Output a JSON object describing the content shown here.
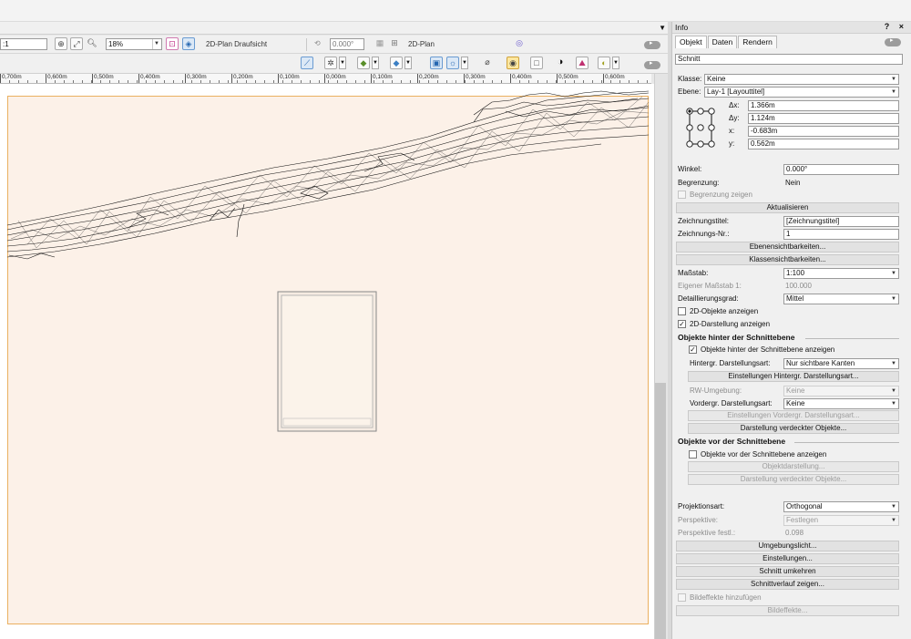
{
  "view_bar": {
    "scale_value": ":1",
    "zoom_value": "18%",
    "plan_label": "2D-Plan Draufsicht",
    "angle_value": "0.000°",
    "plan2_label": "2D-Plan"
  },
  "ruler": {
    "labels": [
      "0,700m",
      "0,600m",
      "0,500m",
      "0,400m",
      "0,300m",
      "0,200m",
      "0,100m",
      "0,000m",
      "0,100m",
      "0,200m",
      "0,300m",
      "0,400m",
      "0,500m",
      "0,600m"
    ]
  },
  "palette": {
    "title": "Info",
    "controls": "? ×",
    "tabs": [
      "Objekt",
      "Daten",
      "Rendern"
    ],
    "object_type": "Schnitt",
    "klasse_label": "Klasse:",
    "klasse_value": "Keine",
    "ebene_label": "Ebene:",
    "ebene_value": "Lay-1 [Layouttitel]",
    "dx_label": "Δx:",
    "dx_value": "1.366m",
    "dy_label": "Δy:",
    "dy_value": "1.124m",
    "x_label": "x:",
    "x_value": "-0.683m",
    "y_label": "y:",
    "y_value": "0.562m",
    "winkel_label": "Winkel:",
    "winkel_value": "0.000°",
    "begrenzung_label": "Begrenzung:",
    "begrenzung_value": "Nein",
    "begrenzung_zeigen": "Begrenzung zeigen",
    "aktualisieren": "Aktualisieren",
    "zeichnungstitel_label": "Zeichnungstitel:",
    "zeichnungstitel_value": "[Zeichnungstitel]",
    "zeichnungsnr_label": "Zeichnungs-Nr.:",
    "zeichnungsnr_value": "1",
    "ebenensichtbarkeiten": "Ebenensichtbarkeiten...",
    "klassensichtbarkeiten": "Klassensichtbarkeiten...",
    "massstab_label": "Maßstab:",
    "massstab_value": "1:100",
    "eigener_label": "Eigener Maßstab 1:",
    "eigener_value": "100.000",
    "detail_label": "Detaillierungsgrad:",
    "detail_value": "Mittel",
    "show_2d_objects": "2D-Objekte anzeigen",
    "show_2d_display": "2D-Darstellung anzeigen",
    "behind_header": "Objekte hinter der Schnittebene",
    "behind_show": "Objekte hinter der Schnittebene anzeigen",
    "hintergr_label": "Hintergr. Darstellungsart:",
    "hintergr_value": "Nur sichtbare Kanten",
    "hintergr_settings": "Einstellungen Hintergr. Darstellungsart...",
    "rw_label": "RW-Umgebung:",
    "rw_value": "Keine",
    "vordergr_label": "Vordergr. Darstellungsart:",
    "vordergr_value": "Keine",
    "vordergr_settings": "Einstellungen Vordergr. Darstellungsart...",
    "verdeckt_btn": "Darstellung verdeckter Objekte...",
    "front_header": "Objekte vor der Schnittebene",
    "front_show": "Objekte vor der Schnittebene anzeigen",
    "objektdarstellung": "Objektdarstellung...",
    "front_verdeckt": "Darstellung verdeckter Objekte...",
    "projektionsart_label": "Projektionsart:",
    "projektionsart_value": "Orthogonal",
    "perspektive_label": "Perspektive:",
    "perspektive_value": "Festlegen",
    "perspektive_festl_label": "Perspektive festl.:",
    "perspektive_festl_value": "0.098",
    "umgebungslicht": "Umgebungslicht...",
    "einstellungen": "Einstellungen...",
    "schnitt_umkehren": "Schnitt umkehren",
    "schnittverlauf": "Schnittverlauf zeigen...",
    "bildeffekte_add": "Bildeffekte hinzufügen",
    "bildeffekte": "Bildeffekte..."
  }
}
